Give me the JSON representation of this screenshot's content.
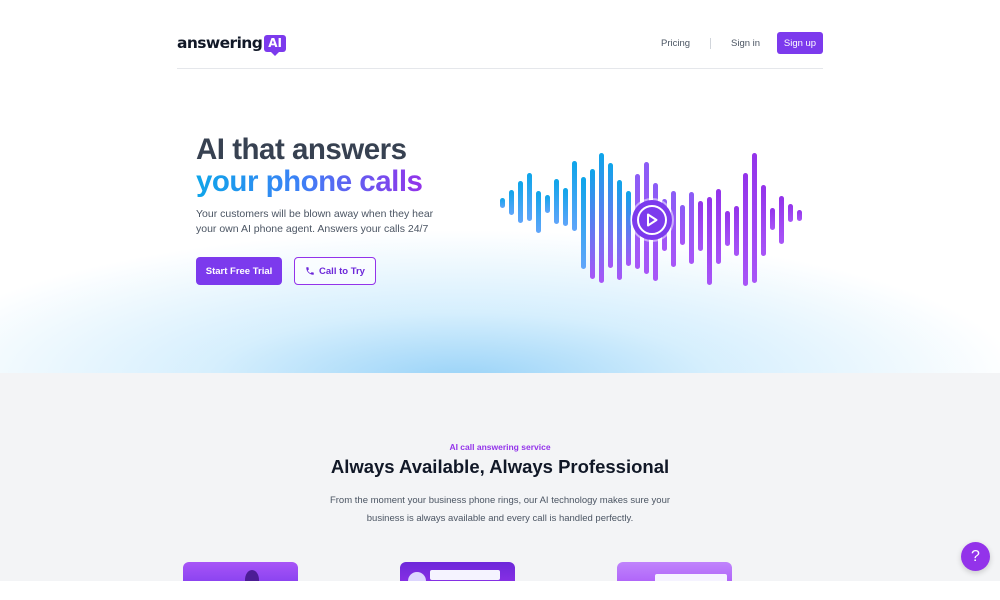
{
  "nav": {
    "logo_text": "answering",
    "logo_badge": "AI",
    "pricing": "Pricing",
    "signin": "Sign in",
    "signup": "Sign up"
  },
  "hero": {
    "headline_line1": "AI that answers",
    "headline_line2": "your phone calls",
    "subtitle": "Your customers will be blown away when they hear your own AI phone agent. Answers your calls 24/7",
    "cta_primary": "Start Free Trial",
    "cta_secondary": "Call to Try",
    "play_icon": "play-icon",
    "phone_icon": "phone-icon"
  },
  "services": {
    "eyebrow": "AI call answering service",
    "title": "Always Available, Always Professional",
    "description": "From the moment your business phone rings, our AI technology makes sure your business is always available and every call is handled perfectly."
  },
  "help": {
    "label": "?",
    "icon": "help-icon"
  },
  "colors": {
    "brand": "#7c3aed",
    "accent_cyan": "#0ea5e9",
    "accent_purple": "#9333ea",
    "section_bg": "#f3f4f6"
  }
}
